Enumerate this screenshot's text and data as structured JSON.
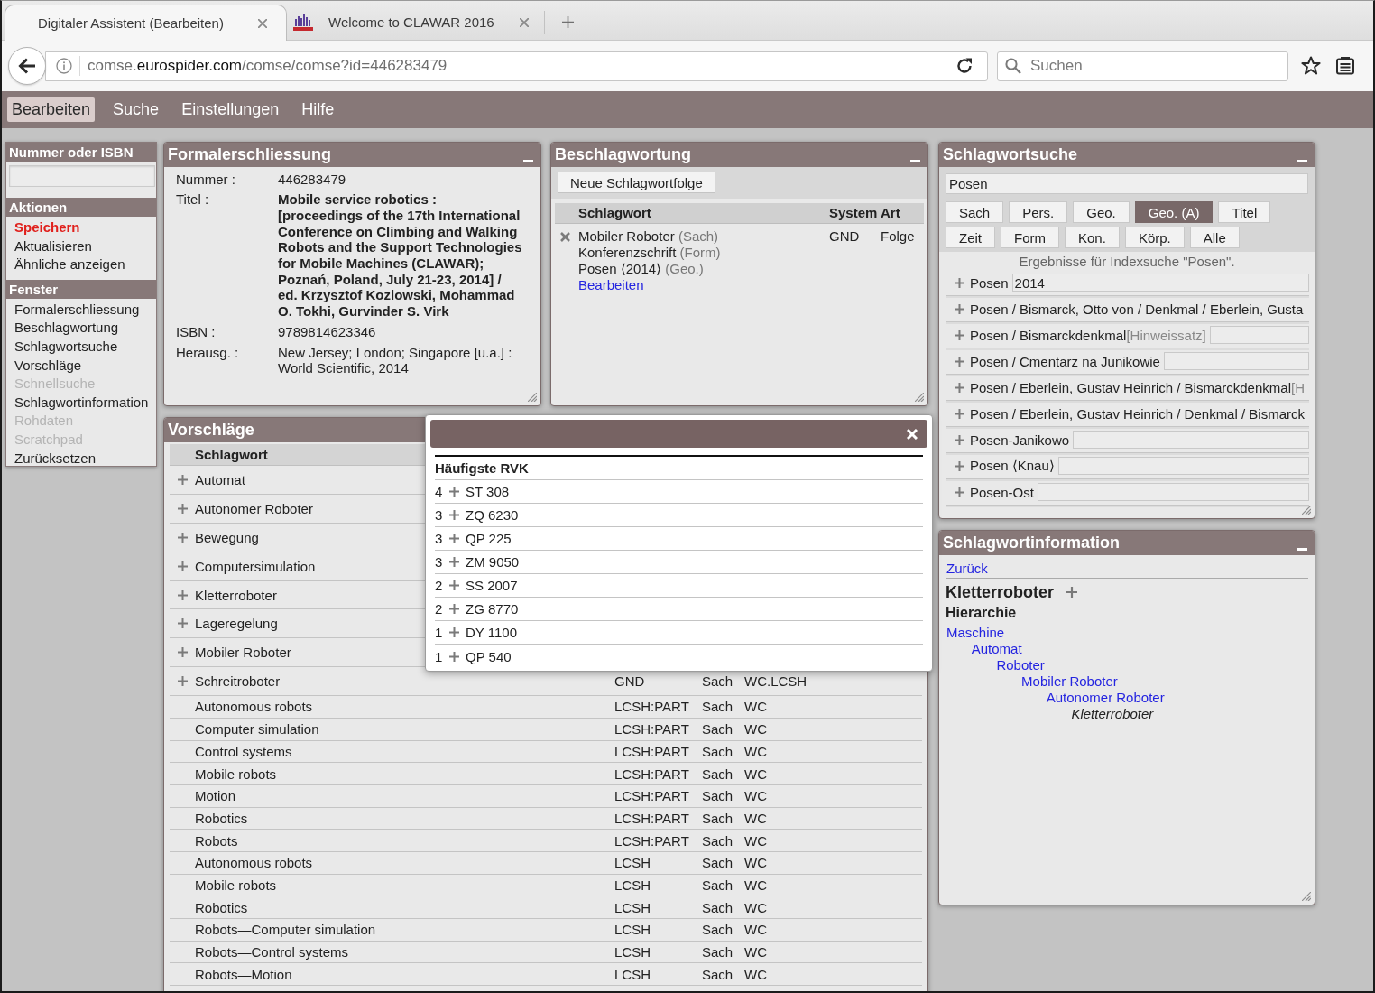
{
  "browser": {
    "tabs": [
      {
        "title": "Digitaler Assistent (Bearbeiten)",
        "kind": "plain",
        "selected": true
      },
      {
        "title": "Welcome to CLAWAR 2016",
        "kind": "with-icon",
        "selected": false
      }
    ],
    "address": {
      "prefix": "comse.",
      "domain": "eurospider.com",
      "path": "/comse/comse?id=446283479"
    },
    "search": {
      "placeholder": "Suchen"
    }
  },
  "menu": [
    {
      "label": "Bearbeiten",
      "selected": true
    },
    {
      "label": "Suche",
      "selected": false
    },
    {
      "label": "Einstellungen",
      "selected": false
    },
    {
      "label": "Hilfe",
      "selected": false
    }
  ],
  "sidebar": {
    "sections": [
      {
        "title": "Nummer oder ISBN",
        "kind": "input"
      },
      {
        "title": "Aktionen",
        "kind": "list",
        "items": [
          {
            "label": "Speichern",
            "kind": "primary",
            "disabled": false
          },
          {
            "label": "Aktualisieren",
            "kind": "link",
            "disabled": false
          },
          {
            "label": "Ähnliche anzeigen",
            "kind": "link",
            "disabled": false
          }
        ]
      },
      {
        "title": "Fenster",
        "kind": "list",
        "items": [
          {
            "label": "Formalerschliessung",
            "kind": "link",
            "disabled": false
          },
          {
            "label": "Beschlagwortung",
            "kind": "link",
            "disabled": false
          },
          {
            "label": "Schlagwortsuche",
            "kind": "link",
            "disabled": false
          },
          {
            "label": "Vorschläge",
            "kind": "link",
            "disabled": false
          },
          {
            "label": "Schnellsuche",
            "kind": "link",
            "disabled": true
          },
          {
            "label": "Schlagwortinformation",
            "kind": "link",
            "disabled": false
          },
          {
            "label": "Rohdaten",
            "kind": "link",
            "disabled": true
          },
          {
            "label": "Scratchpad",
            "kind": "link",
            "disabled": true
          },
          {
            "label": "Zurücksetzen",
            "kind": "link",
            "disabled": false
          }
        ]
      }
    ]
  },
  "formalerschliessung": {
    "title": "Formalerschliessung",
    "fields": [
      {
        "label": "Nummer :",
        "value": "446283479",
        "bold": false
      },
      {
        "label": "Titel :",
        "value": "Mobile service robotics :",
        "continuation": "[proceedings of the 17th International Conference on Climbing and Walking Robots and the Support Technologies for Mobile Machines (CLAWAR); Poznań, Poland, July 21-23, 2014] / ed. Krzysztof Kozlowski, Mohammad O. Tokhi, Gurvinder S. Virk",
        "bold": true
      },
      {
        "label": "ISBN :",
        "value": "9789814623346",
        "bold": false
      },
      {
        "label": "Herausg. :",
        "value": "New Jersey; London; Singapore [u.a.] : World Scientific, 2014",
        "bold": false
      }
    ]
  },
  "beschlagwortung": {
    "title": "Beschlagwortung",
    "button": "Neue Schlagwortfolge",
    "columns": [
      "Schlagwort",
      "System",
      "Art"
    ],
    "rows": [
      {
        "entries": [
          {
            "term": "Mobiler Roboter",
            "qualifier": "(Sach)"
          },
          {
            "term": "Konferenzschrift",
            "qualifier": "(Form)"
          },
          {
            "term": "Posen ⟨2014⟩",
            "qualifier": "(Geo.)"
          }
        ],
        "link": "Bearbeiten",
        "system": "GND",
        "art": "Folge"
      }
    ]
  },
  "schlagwortsuche": {
    "title": "Schlagwortsuche",
    "query": "Posen",
    "filter_rows": [
      {
        "buttons": [
          {
            "label": "Sach",
            "selected": false
          },
          {
            "label": "Pers.",
            "selected": false
          },
          {
            "label": "Geo.",
            "selected": false
          },
          {
            "label": "Geo. (A)",
            "selected": true
          },
          {
            "label": "Titel",
            "selected": false
          }
        ]
      },
      {
        "buttons": [
          {
            "label": "Zeit",
            "selected": false
          },
          {
            "label": "Form",
            "selected": false
          },
          {
            "label": "Kon.",
            "selected": false
          },
          {
            "label": "Körp.",
            "selected": false
          },
          {
            "label": "Alle",
            "selected": false
          }
        ]
      }
    ],
    "caption": "Ergebnisse für Indexsuche \"Posen\".",
    "results": [
      {
        "term": "Posen",
        "kind": "field",
        "value": "2014"
      },
      {
        "term": "Posen / Bismarck, Otto von / Denkmal / Eberlein, Gusta",
        "kind": "plain"
      },
      {
        "term": "Posen / Bismarckdenkmal",
        "hint": "[Hinweissatz]",
        "kind": "field"
      },
      {
        "term": "Posen / Cmentarz na Junikowie",
        "kind": "field"
      },
      {
        "term": "Posen / Eberlein, Gustav Heinrich / Bismarckdenkmal",
        "hint": "[H",
        "kind": "plain"
      },
      {
        "term": "Posen / Eberlein, Gustav Heinrich / Denkmal / Bismarck",
        "kind": "plain"
      },
      {
        "term": "Posen-Janikowo",
        "kind": "field"
      },
      {
        "term": "Posen ⟨Knau⟩",
        "kind": "field"
      },
      {
        "term": "Posen-Ost",
        "kind": "field"
      }
    ]
  },
  "schlagwortinformation": {
    "title": "Schlagwortinformation",
    "back": "Zurück",
    "heading": "Kletterroboter",
    "subheading": "Hierarchie",
    "hierarchy": [
      {
        "label": "Maschine",
        "current": false,
        "children": [
          {
            "label": "Automat",
            "current": false,
            "children": [
              {
                "label": "Roboter",
                "current": false,
                "children": [
                  {
                    "label": "Mobiler Roboter",
                    "current": false,
                    "children": [
                      {
                        "label": "Autonomer Roboter",
                        "current": false,
                        "children": [
                          {
                            "label": "Kletterroboter",
                            "current": true
                          }
                        ]
                      }
                    ]
                  }
                ]
              }
            ]
          }
        ]
      }
    ]
  },
  "vorschlaege": {
    "title": "Vorschläge",
    "columns": [
      "Schlagwort"
    ],
    "rows": [
      {
        "term": "Automat",
        "kind": "addable"
      },
      {
        "term": "Autonomer Roboter",
        "kind": "addable"
      },
      {
        "term": "Bewegung",
        "kind": "addable"
      },
      {
        "term": "Computersimulation",
        "kind": "addable"
      },
      {
        "term": "Kletterroboter",
        "kind": "addable"
      },
      {
        "term": "Lageregelung",
        "kind": "addable"
      },
      {
        "term": "Mobiler Roboter",
        "kind": "addable"
      },
      {
        "term": "Schreitroboter",
        "kind": "addable",
        "column_2": "GND",
        "column_3": "Sach",
        "column_4": "WC.LCSH"
      },
      {
        "term": "Autonomous robots",
        "kind": "plain",
        "column_2": "LCSH:PART",
        "column_3": "Sach",
        "column_4": "WC"
      },
      {
        "term": "Computer simulation",
        "kind": "plain",
        "column_2": "LCSH:PART",
        "column_3": "Sach",
        "column_4": "WC"
      },
      {
        "term": "Control systems",
        "kind": "plain",
        "column_2": "LCSH:PART",
        "column_3": "Sach",
        "column_4": "WC"
      },
      {
        "term": "Mobile robots",
        "kind": "plain",
        "column_2": "LCSH:PART",
        "column_3": "Sach",
        "column_4": "WC"
      },
      {
        "term": "Motion",
        "kind": "plain",
        "column_2": "LCSH:PART",
        "column_3": "Sach",
        "column_4": "WC"
      },
      {
        "term": "Robotics",
        "kind": "plain",
        "column_2": "LCSH:PART",
        "column_3": "Sach",
        "column_4": "WC"
      },
      {
        "term": "Robots",
        "kind": "plain",
        "column_2": "LCSH:PART",
        "column_3": "Sach",
        "column_4": "WC"
      },
      {
        "term": "Autonomous robots",
        "kind": "plain",
        "column_2": "LCSH",
        "column_3": "Sach",
        "column_4": "WC"
      },
      {
        "term": "Mobile robots",
        "kind": "plain",
        "column_2": "LCSH",
        "column_3": "Sach",
        "column_4": "WC"
      },
      {
        "term": "Robotics",
        "kind": "plain",
        "column_2": "LCSH",
        "column_3": "Sach",
        "column_4": "WC"
      },
      {
        "term": "Robots—Computer simulation",
        "kind": "plain",
        "column_2": "LCSH",
        "column_3": "Sach",
        "column_4": "WC"
      },
      {
        "term": "Robots—Control systems",
        "kind": "plain",
        "column_2": "LCSH",
        "column_3": "Sach",
        "column_4": "WC"
      },
      {
        "term": "Robots—Motion",
        "kind": "plain",
        "column_2": "LCSH",
        "column_3": "Sach",
        "column_4": "WC"
      }
    ]
  },
  "rvk_dialog": {
    "heading": "Häufigste RVK",
    "rows": [
      {
        "count": "4",
        "code": "ST 308"
      },
      {
        "count": "3",
        "code": "ZQ 6230"
      },
      {
        "count": "3",
        "code": "QP 225"
      },
      {
        "count": "3",
        "code": "ZM 9050"
      },
      {
        "count": "2",
        "code": "SS 2007"
      },
      {
        "count": "2",
        "code": "ZG 8770"
      },
      {
        "count": "1",
        "code": "DY 1100"
      },
      {
        "count": "1",
        "code": "QP 540"
      }
    ]
  }
}
